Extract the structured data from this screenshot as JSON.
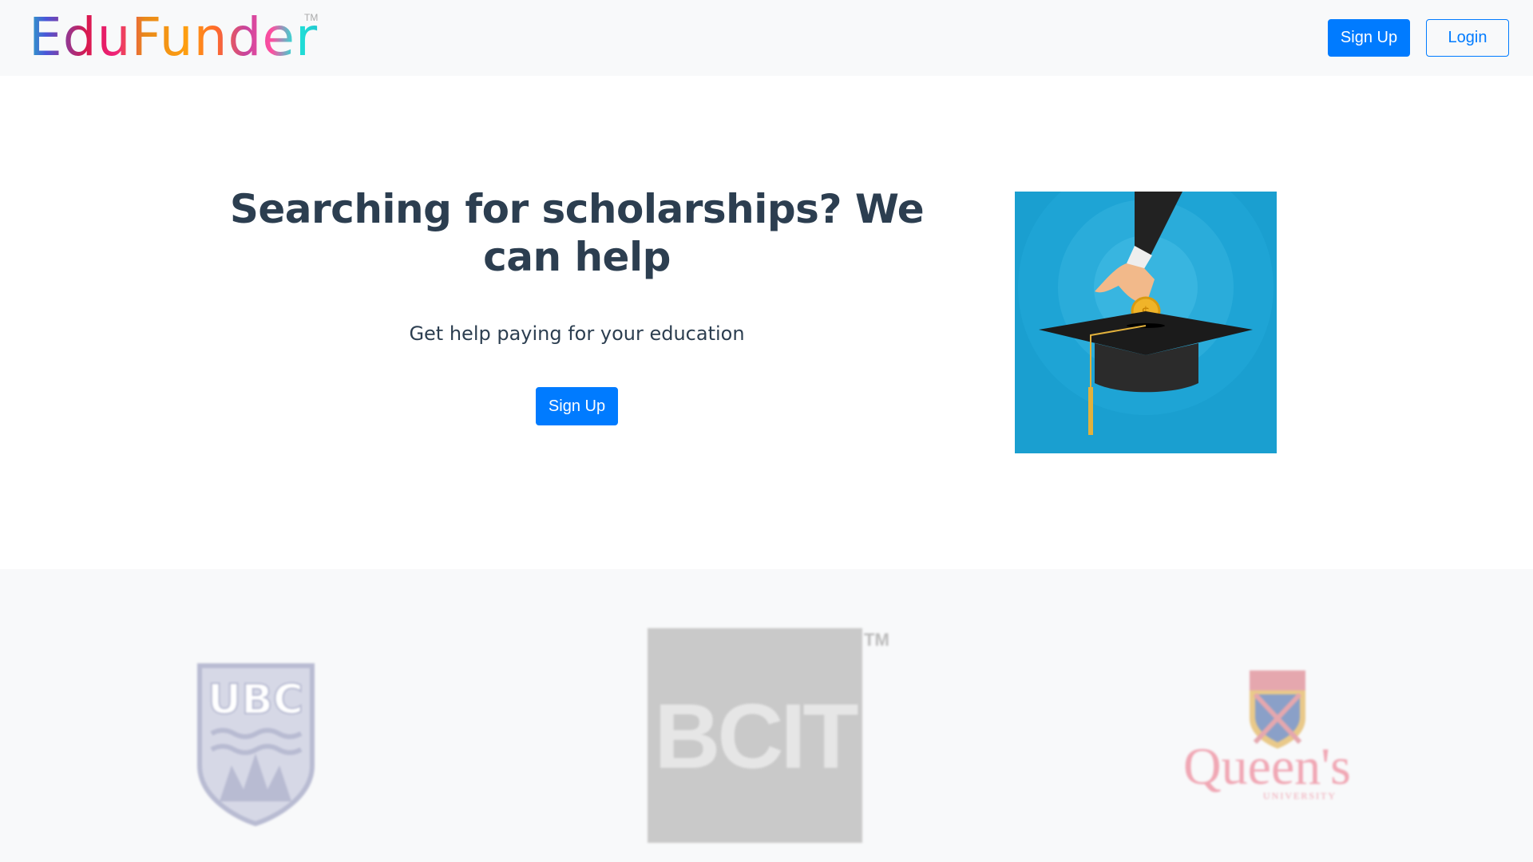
{
  "navbar": {
    "brand": "EduFunder",
    "brand_tm": "TM",
    "signup_label": "Sign Up",
    "login_label": "Login"
  },
  "hero": {
    "heading": "Searching for scholarships? We can help",
    "subheading": "Get help paying for your education",
    "signup_label": "Sign Up",
    "image": "graduation-cap-coin-illustration"
  },
  "partners": {
    "logos": [
      {
        "name": "UBC",
        "text": "UBC"
      },
      {
        "name": "BCIT",
        "text": "BCIT",
        "tm": "TM"
      },
      {
        "name": "Queen's University",
        "text": "Queen's",
        "subtext": "UNIVERSITY"
      }
    ]
  },
  "colors": {
    "primary": "#007bff",
    "text": "#2c3e50",
    "band": "#f8f9fa",
    "image_bg": "#1a9fd0"
  }
}
